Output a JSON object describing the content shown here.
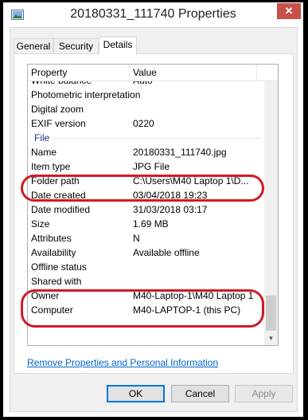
{
  "window": {
    "title": "20180331_111740 Properties",
    "close_glyph": "✕"
  },
  "tabs": [
    {
      "label": "General"
    },
    {
      "label": "Security"
    },
    {
      "label": "Details"
    }
  ],
  "list": {
    "headers": {
      "property": "Property",
      "value": "Value"
    },
    "rows": [
      {
        "k": "White balance",
        "v": "Auto"
      },
      {
        "k": "Photometric interpretation",
        "v": ""
      },
      {
        "k": "Digital zoom",
        "v": ""
      },
      {
        "k": "EXIF version",
        "v": "0220"
      },
      {
        "group": "File"
      },
      {
        "k": "Name",
        "v": "20180331_111740.jpg"
      },
      {
        "k": "Item type",
        "v": "JPG File"
      },
      {
        "k": "Folder path",
        "v": "C:\\Users\\M40 Laptop 1\\D..."
      },
      {
        "k": "Date created",
        "v": "03/04/2018 19:23"
      },
      {
        "k": "Date modified",
        "v": "31/03/2018 03:17"
      },
      {
        "k": "Size",
        "v": "1.69 MB"
      },
      {
        "k": "Attributes",
        "v": "N"
      },
      {
        "k": "Availability",
        "v": "Available offline"
      },
      {
        "k": "Offline status",
        "v": ""
      },
      {
        "k": "Shared with",
        "v": ""
      },
      {
        "k": "Owner",
        "v": "M40-Laptop-1\\M40 Laptop 1"
      },
      {
        "k": "Computer",
        "v": "M40-LAPTOP-1 (this PC)"
      }
    ]
  },
  "links": {
    "remove": "Remove Properties and Personal Information"
  },
  "buttons": {
    "ok": "OK",
    "cancel": "Cancel",
    "apply": "Apply"
  },
  "colors": {
    "highlight": "#d01a24",
    "link": "#0066cc",
    "group_label": "#1e3287",
    "close_button": "#c7504a"
  }
}
